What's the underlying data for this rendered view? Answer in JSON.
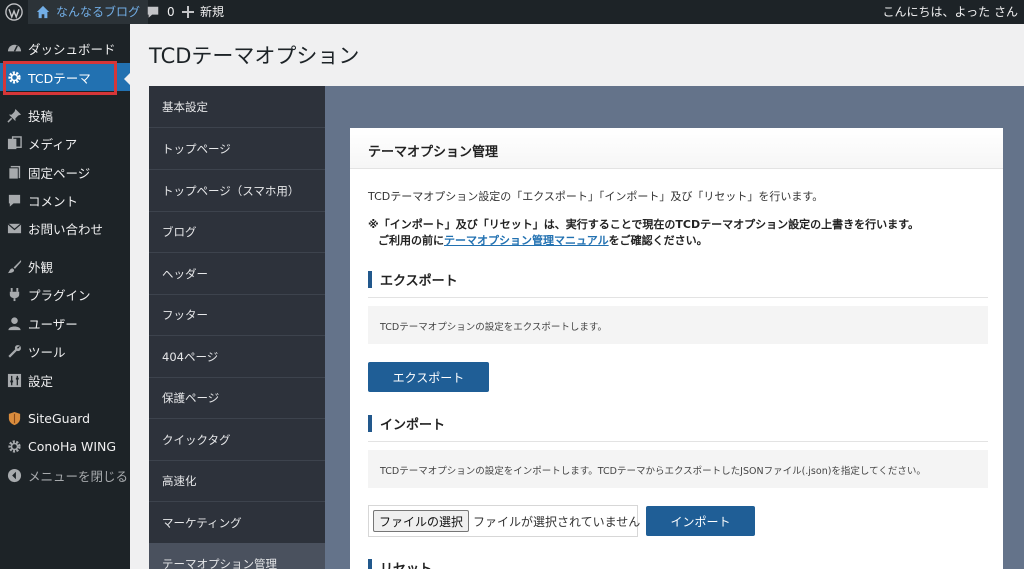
{
  "adminbar": {
    "site_name": "なんなるブログ",
    "comment_count": "0",
    "new_label": "新規",
    "howdy": "こんにちは、よった さん"
  },
  "sidebar": {
    "items": [
      {
        "label": "ダッシュボード",
        "icon": "dashboard-icon"
      },
      {
        "label": "TCDテーマ",
        "icon": "gear-icon"
      },
      {
        "label": "投稿",
        "icon": "pin-icon"
      },
      {
        "label": "メディア",
        "icon": "media-icon"
      },
      {
        "label": "固定ページ",
        "icon": "page-icon"
      },
      {
        "label": "コメント",
        "icon": "comment-icon"
      },
      {
        "label": "お問い合わせ",
        "icon": "mail-icon"
      },
      {
        "label": "外観",
        "icon": "brush-icon"
      },
      {
        "label": "プラグイン",
        "icon": "plugin-icon"
      },
      {
        "label": "ユーザー",
        "icon": "user-icon"
      },
      {
        "label": "ツール",
        "icon": "wrench-icon"
      },
      {
        "label": "設定",
        "icon": "settings-icon"
      },
      {
        "label": "SiteGuard",
        "icon": "siteguard-icon"
      },
      {
        "label": "ConoHa WING",
        "icon": "gear-icon"
      },
      {
        "label": "メニューを閉じる",
        "icon": "collapse-icon"
      }
    ]
  },
  "page_title": "TCDテーマオプション",
  "tabs": [
    "基本設定",
    "トップページ",
    "トップページ（スマホ用）",
    "ブログ",
    "ヘッダー",
    "フッター",
    "404ページ",
    "保護ページ",
    "クイックタグ",
    "高速化",
    "マーケティング",
    "テーマオプション管理"
  ],
  "panel": {
    "title": "テーマオプション管理",
    "intro": "TCDテーマオプション設定の「エクスポート」「インポート」及び「リセット」を行います。",
    "warning_line1": "※「インポート」及び「リセット」は、実行することで現在のTCDテーマオプション設定の上書きを行います。",
    "warning_line2_prefix": "ご利用の前に",
    "warning_link": "テーマオプション管理マニュアル",
    "warning_line2_suffix": "をご確認ください。",
    "export": {
      "title": "エクスポート",
      "note": "TCDテーマオプションの設定をエクスポートします。",
      "button": "エクスポート"
    },
    "import": {
      "title": "インポート",
      "note": "TCDテーマオプションの設定をインポートします。TCDテーマからエクスポートしたJSONファイル(.json)を指定してください。",
      "file_button": "ファイルの選択",
      "file_status": "ファイルが選択されていません",
      "button": "インポート"
    },
    "reset": {
      "title": "リセット"
    }
  },
  "colors": {
    "adminbar_bg": "#1d2327",
    "menu_current": "#2271b1",
    "highlight": "#d63638",
    "tabs_bg": "#2d323b",
    "options_bg": "#64738a",
    "button_blue": "#1f5e96"
  }
}
